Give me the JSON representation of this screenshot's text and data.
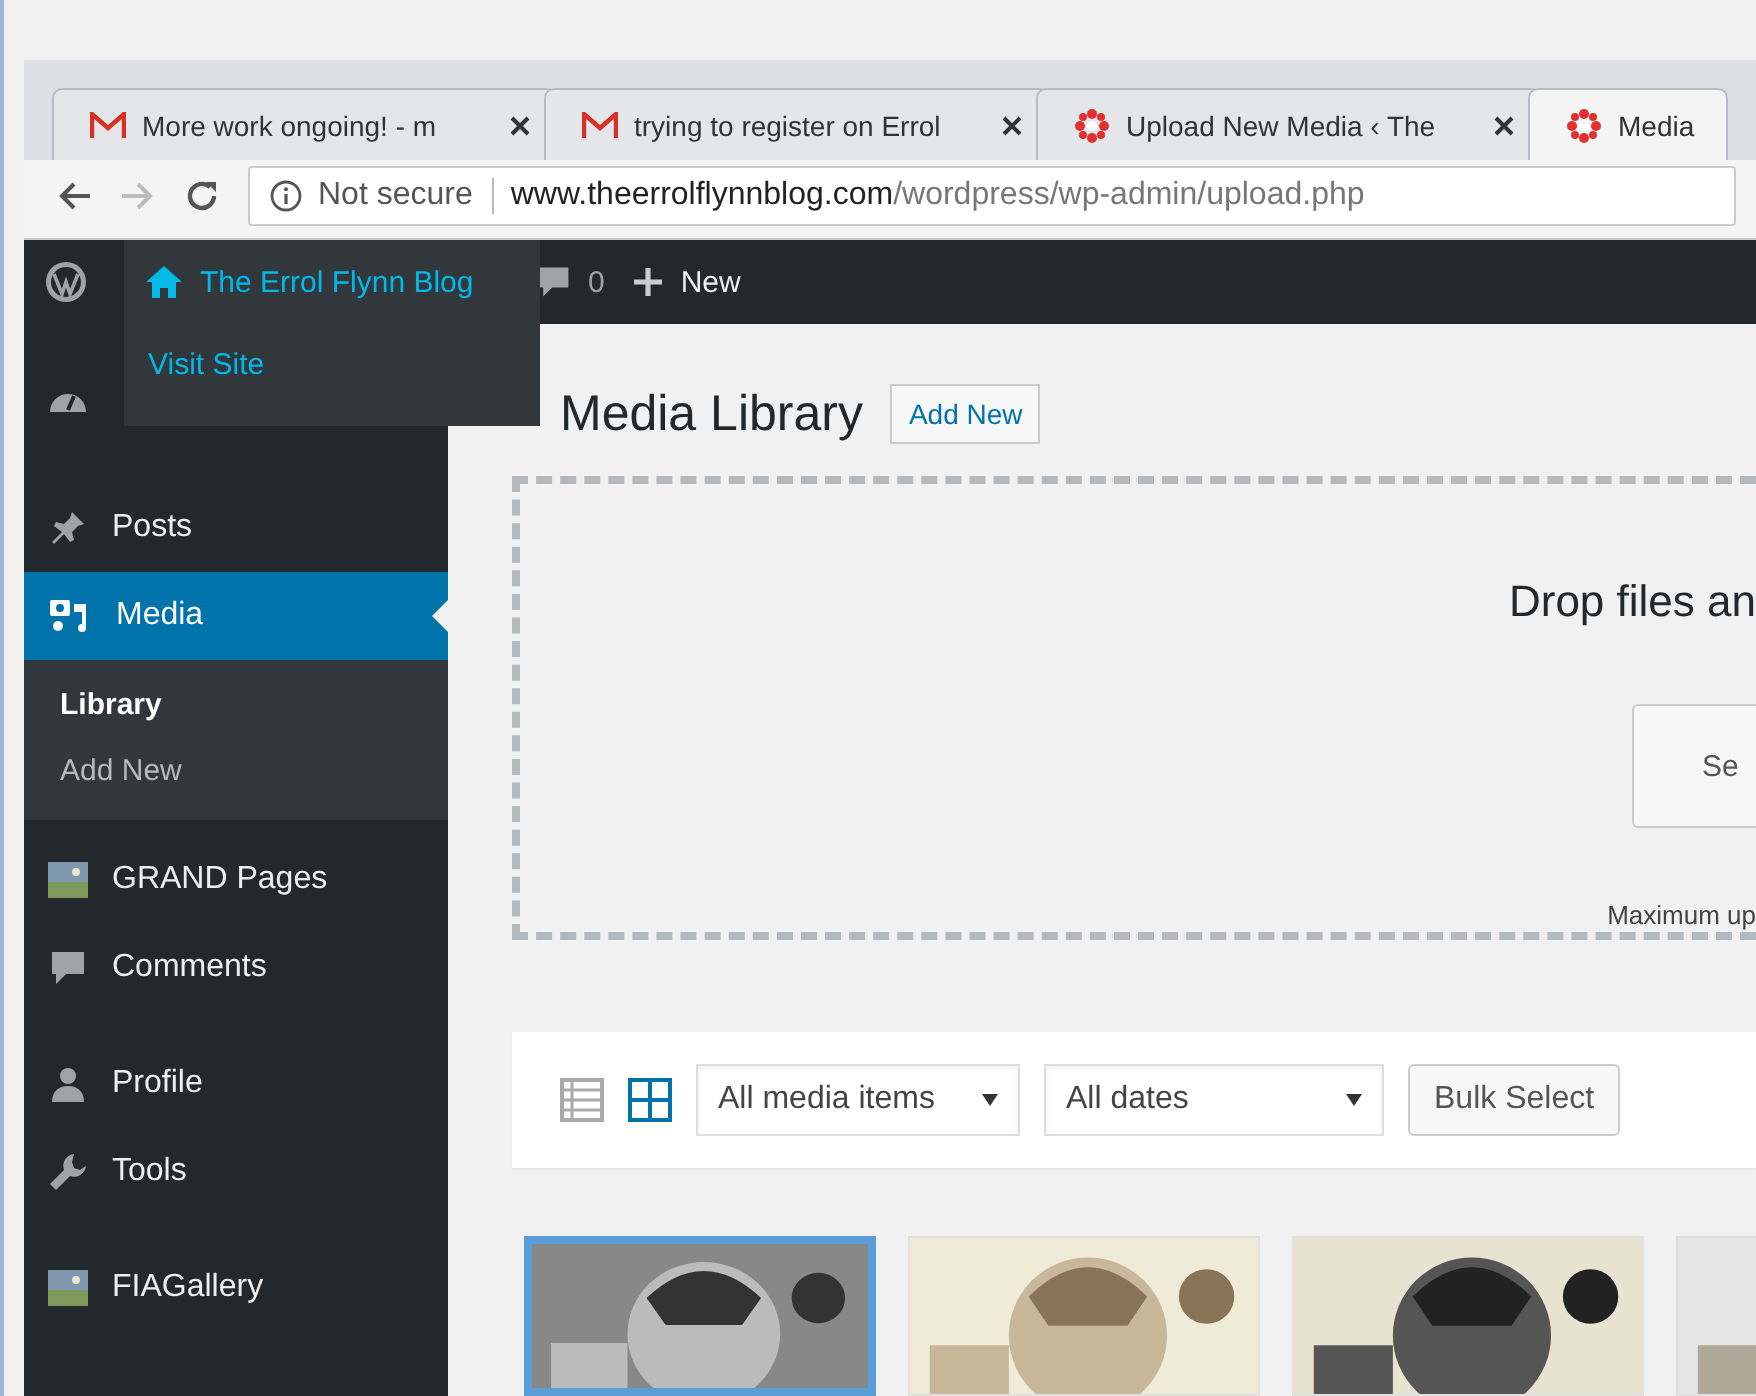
{
  "browser": {
    "tabs": [
      {
        "title": "More work ongoing! - m",
        "selected": false
      },
      {
        "title": "trying to register on Errol",
        "selected": false
      },
      {
        "title": "Upload New Media ‹ The",
        "selected": false
      },
      {
        "title": "Media",
        "selected": true
      }
    ],
    "address": {
      "security": "Not secure",
      "host": "www.theerrolflynnblog.com",
      "path": "/wordpress/wp-admin/upload.php"
    }
  },
  "admin_bar": {
    "site_name": "The Errol Flynn Blog",
    "comments_count": "0",
    "new_label": "New",
    "flyout": {
      "items": [
        "Visit Site"
      ]
    }
  },
  "sidebar": {
    "items": [
      {
        "label": "Posts",
        "selected": false
      },
      {
        "label": "Media",
        "selected": true,
        "children": [
          {
            "label": "Library",
            "selected": true
          },
          {
            "label": "Add New",
            "selected": false
          }
        ]
      },
      {
        "label": "GRAND Pages",
        "selected": false
      },
      {
        "label": "Comments",
        "selected": false
      },
      {
        "label": "Profile",
        "selected": false
      },
      {
        "label": "Tools",
        "selected": false
      },
      {
        "label": "FIAGallery",
        "selected": false
      }
    ]
  },
  "main": {
    "title": "Media Library",
    "add_new": "Add New",
    "dropzone": {
      "prompt": "Drop files an",
      "button": "Se",
      "note": "Maximum up"
    },
    "toolbar": {
      "view_modes": [
        {
          "selected": false
        },
        {
          "selected": true
        }
      ],
      "filters": [
        {
          "value": "All media items"
        },
        {
          "value": "All dates"
        }
      ],
      "bulk_select": "Bulk Select"
    },
    "thumbnails": [
      {
        "kind": "picture",
        "selected": true
      },
      {
        "kind": "picture",
        "selected": false
      },
      {
        "kind": "picture",
        "selected": false
      },
      {
        "kind": "picture",
        "selected": false
      }
    ]
  }
}
